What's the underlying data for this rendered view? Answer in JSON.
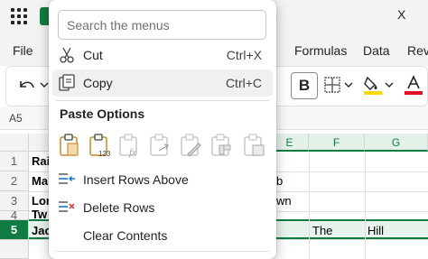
{
  "app": {
    "tabs": [
      "File",
      "Formulas",
      "Data",
      "Rev"
    ],
    "title_right": "X",
    "name_box": "A5",
    "colors": {
      "excel_green": "#107c41",
      "fill_yellow": "#ffd800",
      "font_red": "#e81123"
    }
  },
  "ribbon": {
    "bold_label": "B"
  },
  "grid": {
    "columns": [
      "E",
      "F",
      "G"
    ],
    "rows": [
      {
        "num": "1",
        "a": "Rai",
        "e": "",
        "f": "",
        "g": ""
      },
      {
        "num": "2",
        "a": "Ma",
        "e": "b",
        "f": "",
        "g": ""
      },
      {
        "num": "3",
        "a": "Lor",
        "e": "wn",
        "f": "",
        "g": ""
      },
      {
        "num": "4",
        "a": "Tw",
        "e": "",
        "f": "",
        "g": ""
      },
      {
        "num": "5",
        "a": "Jac",
        "e": "",
        "f": "The",
        "g": "Hill"
      }
    ]
  },
  "context_menu": {
    "search_placeholder": "Search the menus",
    "cut": {
      "label": "Cut",
      "shortcut": "Ctrl+X",
      "icon": "scissors-icon"
    },
    "copy": {
      "label": "Copy",
      "shortcut": "Ctrl+C",
      "icon": "copy-icon"
    },
    "paste_options_title": "Paste Options",
    "paste_options": [
      "paste-icon",
      "paste-values-icon",
      "paste-formulas-icon",
      "paste-link-icon",
      "paste-formatting-icon",
      "paste-transpose-icon",
      "paste-picture-icon"
    ],
    "insert_rows_above": {
      "label": "Insert Rows Above",
      "icon": "insert-rows-icon"
    },
    "delete_rows": {
      "label": "Delete Rows",
      "icon": "delete-rows-icon"
    },
    "clear_contents": {
      "label": "Clear Contents"
    }
  }
}
